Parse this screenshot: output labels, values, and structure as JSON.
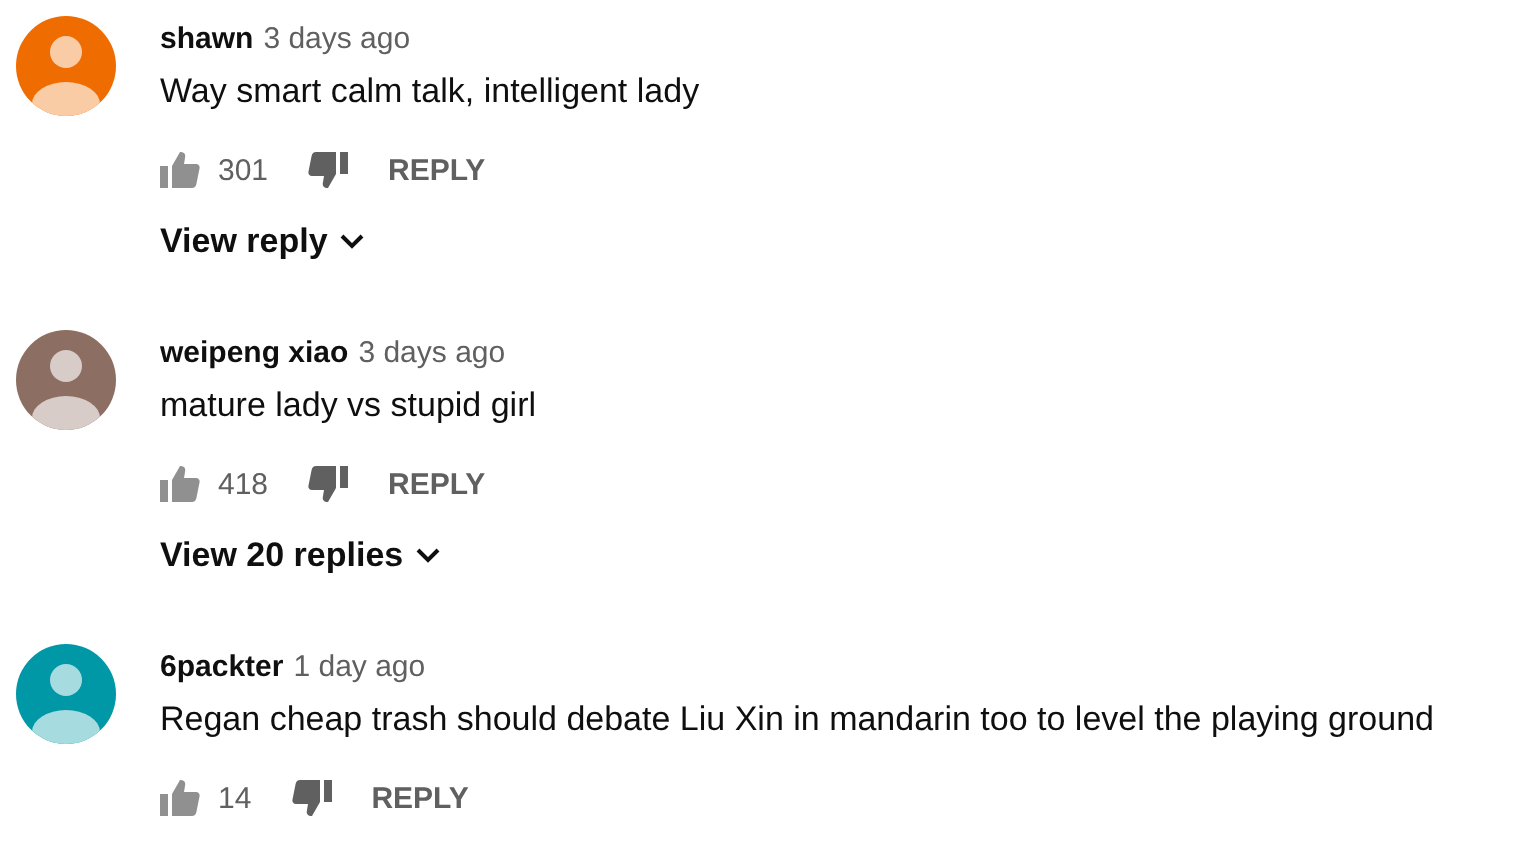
{
  "comments": [
    {
      "author": "shawn",
      "time": "3 days ago",
      "color": "#ef6c00",
      "text": "Way smart calm talk, intelligent lady",
      "likes": "301",
      "reply": "REPLY",
      "replies_link": "View reply"
    },
    {
      "author": "weipeng xiao",
      "time": "3 days ago",
      "color": "#8d6e63",
      "text": "mature lady vs stupid girl",
      "likes": "418",
      "reply": "REPLY",
      "replies_link": "View 20 replies"
    },
    {
      "author": "6packter",
      "time": "1 day ago",
      "color": "#0097a7",
      "text": "Regan cheap trash should debate Liu Xin in mandarin too to level the playing ground",
      "likes": "14",
      "reply": "REPLY"
    }
  ]
}
